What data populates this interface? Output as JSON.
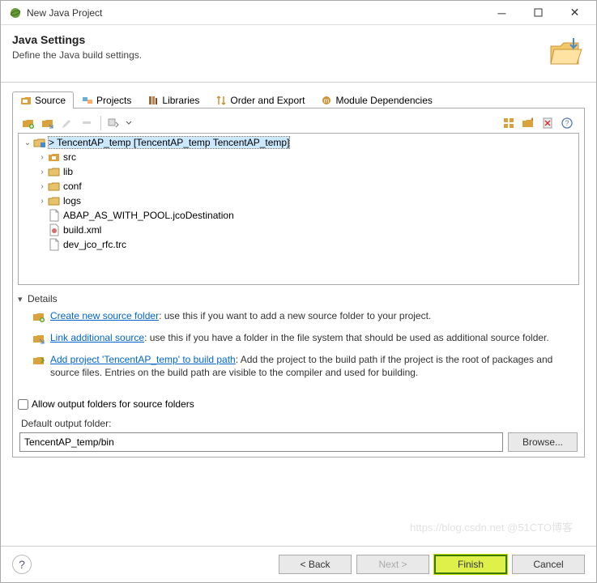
{
  "window": {
    "title": "New Java Project"
  },
  "header": {
    "title": "Java Settings",
    "subtitle": "Define the Java build settings."
  },
  "tabs": [
    {
      "label": "Source",
      "active": true
    },
    {
      "label": "Projects",
      "active": false
    },
    {
      "label": "Libraries",
      "active": false
    },
    {
      "label": "Order and Export",
      "active": false
    },
    {
      "label": "Module Dependencies",
      "active": false
    }
  ],
  "tree": {
    "root": {
      "label": "> TencentAP_temp [TencentAP_temp TencentAP_temp]"
    },
    "children": [
      {
        "label": "src",
        "expandable": true,
        "icon": "package"
      },
      {
        "label": "lib",
        "expandable": true,
        "icon": "folder"
      },
      {
        "label": "conf",
        "expandable": true,
        "icon": "folder"
      },
      {
        "label": "logs",
        "expandable": true,
        "icon": "folder"
      },
      {
        "label": "ABAP_AS_WITH_POOL.jcoDestination",
        "expandable": false,
        "icon": "file"
      },
      {
        "label": "build.xml",
        "expandable": false,
        "icon": "ant"
      },
      {
        "label": "dev_jco_rfc.trc",
        "expandable": false,
        "icon": "file"
      }
    ]
  },
  "details": {
    "header": "Details",
    "items": [
      {
        "link": "Create new source folder",
        "text": ": use this if you want to add a new source folder to your project."
      },
      {
        "link": "Link additional source",
        "text": ": use this if you have a folder in the file system that should be used as additional source folder."
      },
      {
        "link": "Add project 'TencentAP_temp' to build path",
        "text": ": Add the project to the build path if the project is the root of packages and source files. Entries on the build path are visible to the compiler and used for building."
      }
    ]
  },
  "output": {
    "checkbox_label": "Allow output folders for source folders",
    "label": "Default output folder:",
    "value": "TencentAP_temp/bin",
    "browse": "Browse..."
  },
  "buttons": {
    "back": "< Back",
    "next": "Next >",
    "finish": "Finish",
    "cancel": "Cancel"
  },
  "watermark": "https://blog.csdn.net @51CTO博客"
}
